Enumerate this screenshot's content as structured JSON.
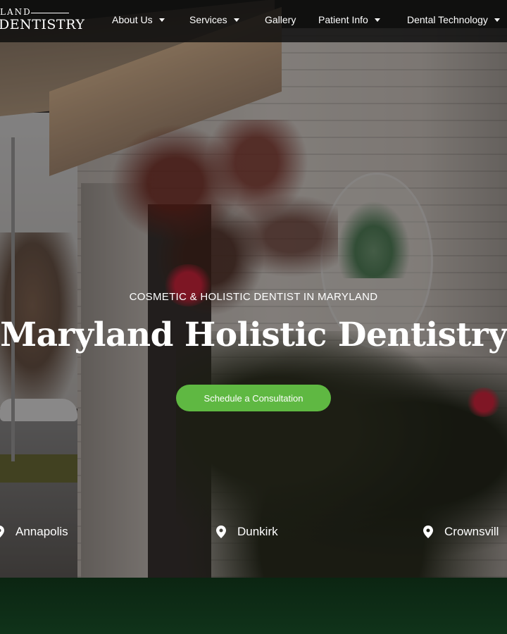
{
  "logo": {
    "top_text": "LAND",
    "main_text": "DENTISTRY"
  },
  "nav": {
    "items": [
      {
        "label": "About Us",
        "has_dropdown": true
      },
      {
        "label": "Services",
        "has_dropdown": true
      },
      {
        "label": "Gallery",
        "has_dropdown": false
      },
      {
        "label": "Patient Info",
        "has_dropdown": true
      },
      {
        "label": "Dental Technology",
        "has_dropdown": true
      }
    ]
  },
  "hero": {
    "kicker": "COSMETIC & HOLISTIC DENTIST IN MARYLAND",
    "title": "Maryland Holistic Dentistry",
    "cta_label": "Schedule a Consultation"
  },
  "locations": [
    {
      "name": "Annapolis",
      "icon": "map-pin-icon"
    },
    {
      "name": "Dunkirk",
      "icon": "map-pin-icon"
    },
    {
      "name": "Crownsvill",
      "icon": "map-pin-icon"
    }
  ],
  "colors": {
    "header_bg": "#0c0c0c",
    "cta_green": "#5fb842",
    "bottom_band": "#0d2a16"
  }
}
